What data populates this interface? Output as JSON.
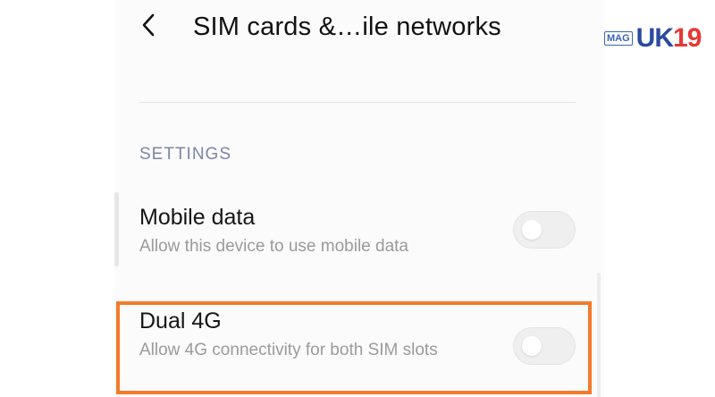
{
  "header": {
    "title": "SIM cards &…ile networks",
    "back_icon": "chevron-left-icon"
  },
  "logo": {
    "mag_text": "MAG",
    "brand_text_main": "UK",
    "brand_text_accent": "19"
  },
  "settings_section": {
    "title": "SETTINGS"
  },
  "items": [
    {
      "title": "Mobile data",
      "subtitle": "Allow this device to use mobile data",
      "enabled": false
    },
    {
      "title": "Dual 4G",
      "subtitle": "Allow 4G connectivity for both SIM slots",
      "enabled": false
    }
  ],
  "colors": {
    "highlight_border": "#f47a2a",
    "section_title": "#7b86a6",
    "brand_blue": "#2b4aa0",
    "brand_red": "#e53935"
  }
}
